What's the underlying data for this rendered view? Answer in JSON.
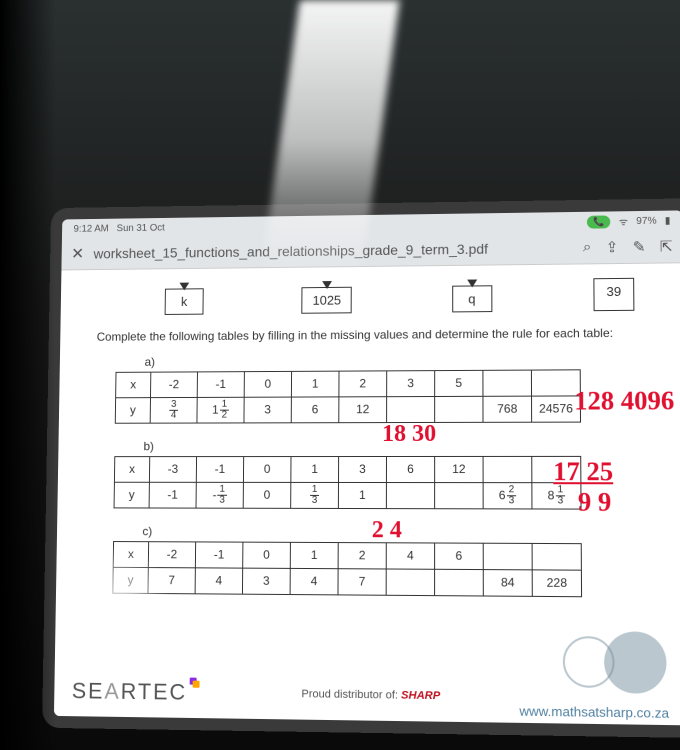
{
  "status": {
    "time": "9:12 AM",
    "date": "Sun 31 Oct",
    "battery": "97%"
  },
  "titlebar": {
    "filename": "worksheet_15_functions_and_relationships_grade_9_term_3.pdf",
    "close": "✕",
    "icons": {
      "search": "⌕",
      "share": "⇪",
      "edit": "✎",
      "open": "⇱"
    }
  },
  "top_boxes": {
    "b1": "k",
    "b2": "1025",
    "b3": "q",
    "b4": "39"
  },
  "instruction": "Complete the following tables by filling in the missing values and determine the rule for each table:",
  "labels": {
    "a": "a)",
    "b": "b)",
    "c": "c)"
  },
  "table_a": {
    "x": [
      "-2",
      "-1",
      "0",
      "1",
      "2",
      "3",
      "5",
      "",
      ""
    ],
    "y": [
      "3/4",
      "1 1/2",
      "3",
      "6",
      "12",
      "",
      "",
      "768",
      "24576"
    ]
  },
  "table_b": {
    "x": [
      "-3",
      "-1",
      "0",
      "1",
      "3",
      "6",
      "12",
      "",
      ""
    ],
    "y": [
      "-1",
      "-1/3",
      "0",
      "1/3",
      "1",
      "",
      "",
      "6 2/3",
      "8 1/3"
    ]
  },
  "table_c": {
    "x": [
      "-2",
      "-1",
      "0",
      "1",
      "2",
      "4",
      "6",
      "",
      ""
    ],
    "y": [
      "7",
      "4",
      "3",
      "4",
      "7",
      "",
      "",
      "84",
      "228"
    ]
  },
  "handwriting": {
    "a_top": "128 4096",
    "a_body": "18 30",
    "b_top": "17  25",
    "b_mid": "9   9",
    "b_body": "2  4"
  },
  "footer": {
    "logo_1": "SE",
    "logo_2": "A",
    "logo_3": "RTEC",
    "dist": "Proud distributor of: ",
    "sharp": "SHARP",
    "url": "www.mathsatsharp.co.za"
  }
}
